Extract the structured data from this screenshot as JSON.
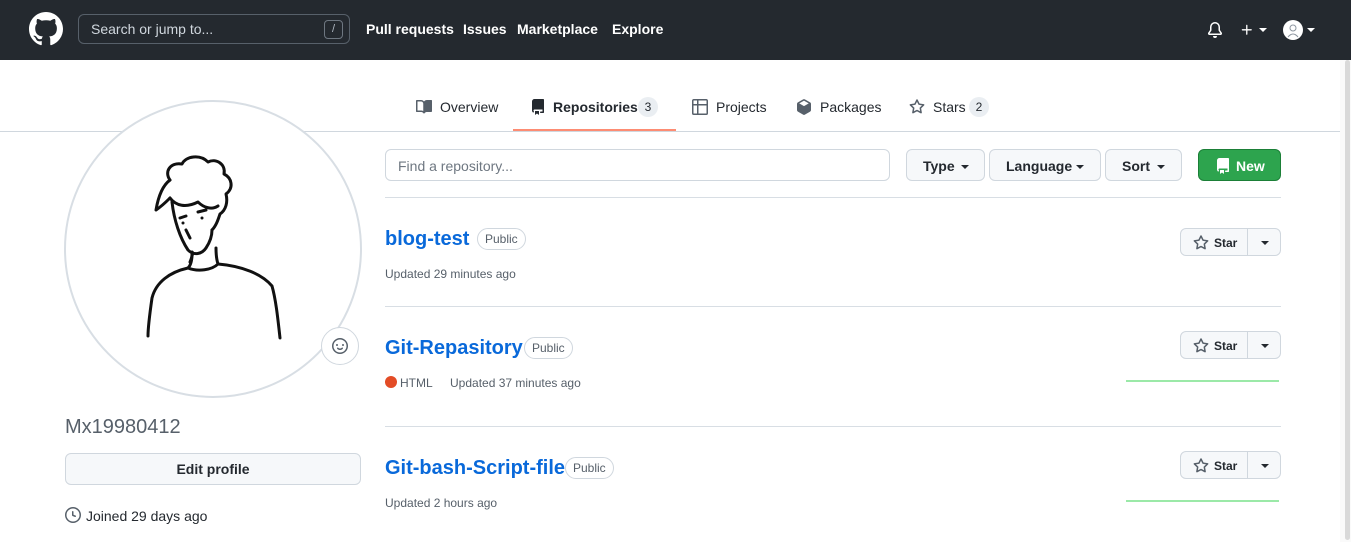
{
  "header": {
    "search_placeholder": "Search or jump to...",
    "search_shortcut": "/",
    "nav": [
      "Pull requests",
      "Issues",
      "Marketplace",
      "Explore"
    ],
    "icons": [
      "github-logo-icon",
      "bell-icon",
      "plus-icon",
      "avatar-icon"
    ]
  },
  "tabs": [
    {
      "label": "Overview",
      "icon": "book-icon",
      "count": null
    },
    {
      "label": "Repositories",
      "icon": "repo-icon",
      "count": "3",
      "selected": true
    },
    {
      "label": "Projects",
      "icon": "table-icon",
      "count": null
    },
    {
      "label": "Packages",
      "icon": "package-icon",
      "count": null
    },
    {
      "label": "Stars",
      "icon": "star-icon",
      "count": "2"
    }
  ],
  "profile": {
    "username": "Mx19980412",
    "edit_label": "Edit profile",
    "joined": "Joined 29 days ago"
  },
  "filters": {
    "find_placeholder": "Find a repository...",
    "type_label": "Type",
    "language_label": "Language",
    "sort_label": "Sort",
    "new_label": "New"
  },
  "repos": [
    {
      "name": "blog-test",
      "visibility": "Public",
      "language": "",
      "updated": "Updated 29 minutes ago",
      "star_label": "Star"
    },
    {
      "name": "Git-Repasitory",
      "visibility": "Public",
      "language": "HTML",
      "language_color": "#e34c26",
      "updated": "Updated 37 minutes ago",
      "star_label": "Star"
    },
    {
      "name": "Git-bash-Script-file",
      "visibility": "Public",
      "language": "",
      "updated": "Updated 2 hours ago",
      "star_label": "Star"
    }
  ],
  "colors": {
    "header_bg": "#24292f",
    "link": "#0969da",
    "new_button": "#2da44e",
    "tab_underline": "#fd8c73",
    "sparkline": "#9be9a8"
  }
}
